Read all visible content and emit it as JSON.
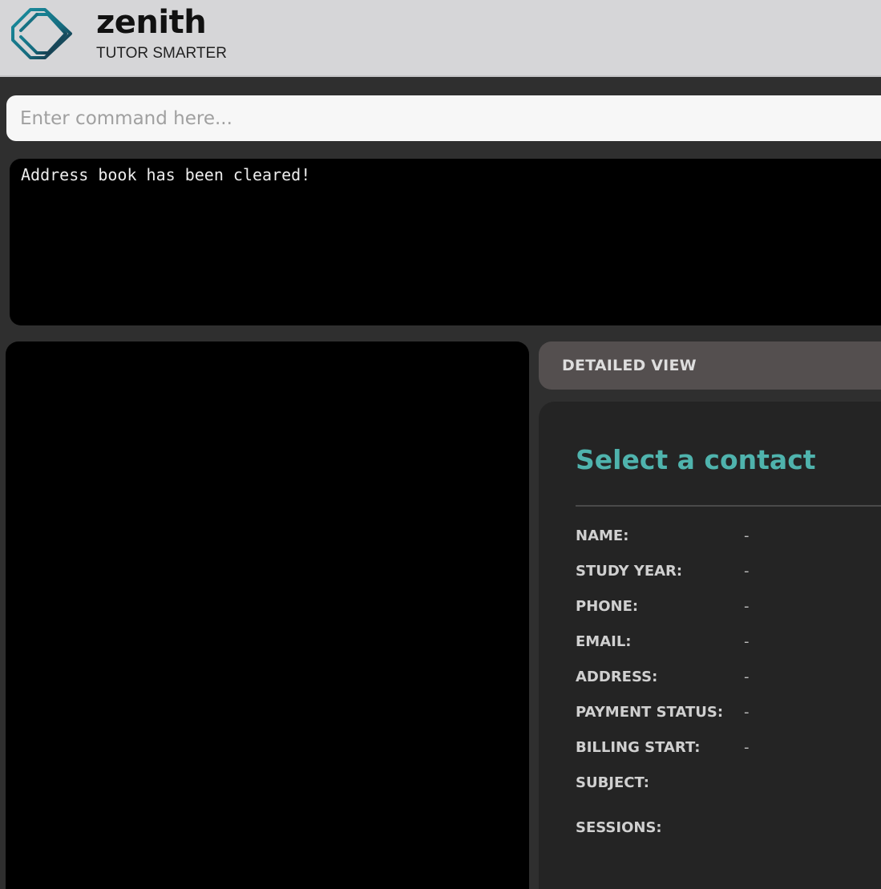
{
  "app": {
    "name": "zenith",
    "tagline": "TUTOR SMARTER"
  },
  "command": {
    "placeholder": "Enter command here...",
    "value": ""
  },
  "result": {
    "message": "Address book has been cleared!"
  },
  "person_list": {
    "items": []
  },
  "detail": {
    "header": "DETAILED VIEW",
    "title": "Select a contact",
    "fields": [
      {
        "label": "NAME:",
        "value": "-"
      },
      {
        "label": "STUDY YEAR:",
        "value": "-"
      },
      {
        "label": "PHONE:",
        "value": "-"
      },
      {
        "label": "EMAIL:",
        "value": "-"
      },
      {
        "label": "ADDRESS:",
        "value": "-"
      },
      {
        "label": "PAYMENT STATUS:",
        "value": "-"
      },
      {
        "label": "BILLING START:",
        "value": "-"
      },
      {
        "label": "SUBJECT:",
        "value": ""
      },
      {
        "label": "SESSIONS:",
        "value": ""
      }
    ]
  },
  "colors": {
    "accent": "#4fb3ad",
    "header_bg": "#d6d6d8",
    "app_bg": "#2f2f2f",
    "detail_header_bg": "#544f4f",
    "detail_card_bg": "#242424"
  },
  "icons": {
    "logo": "zenith-logo-icon"
  }
}
